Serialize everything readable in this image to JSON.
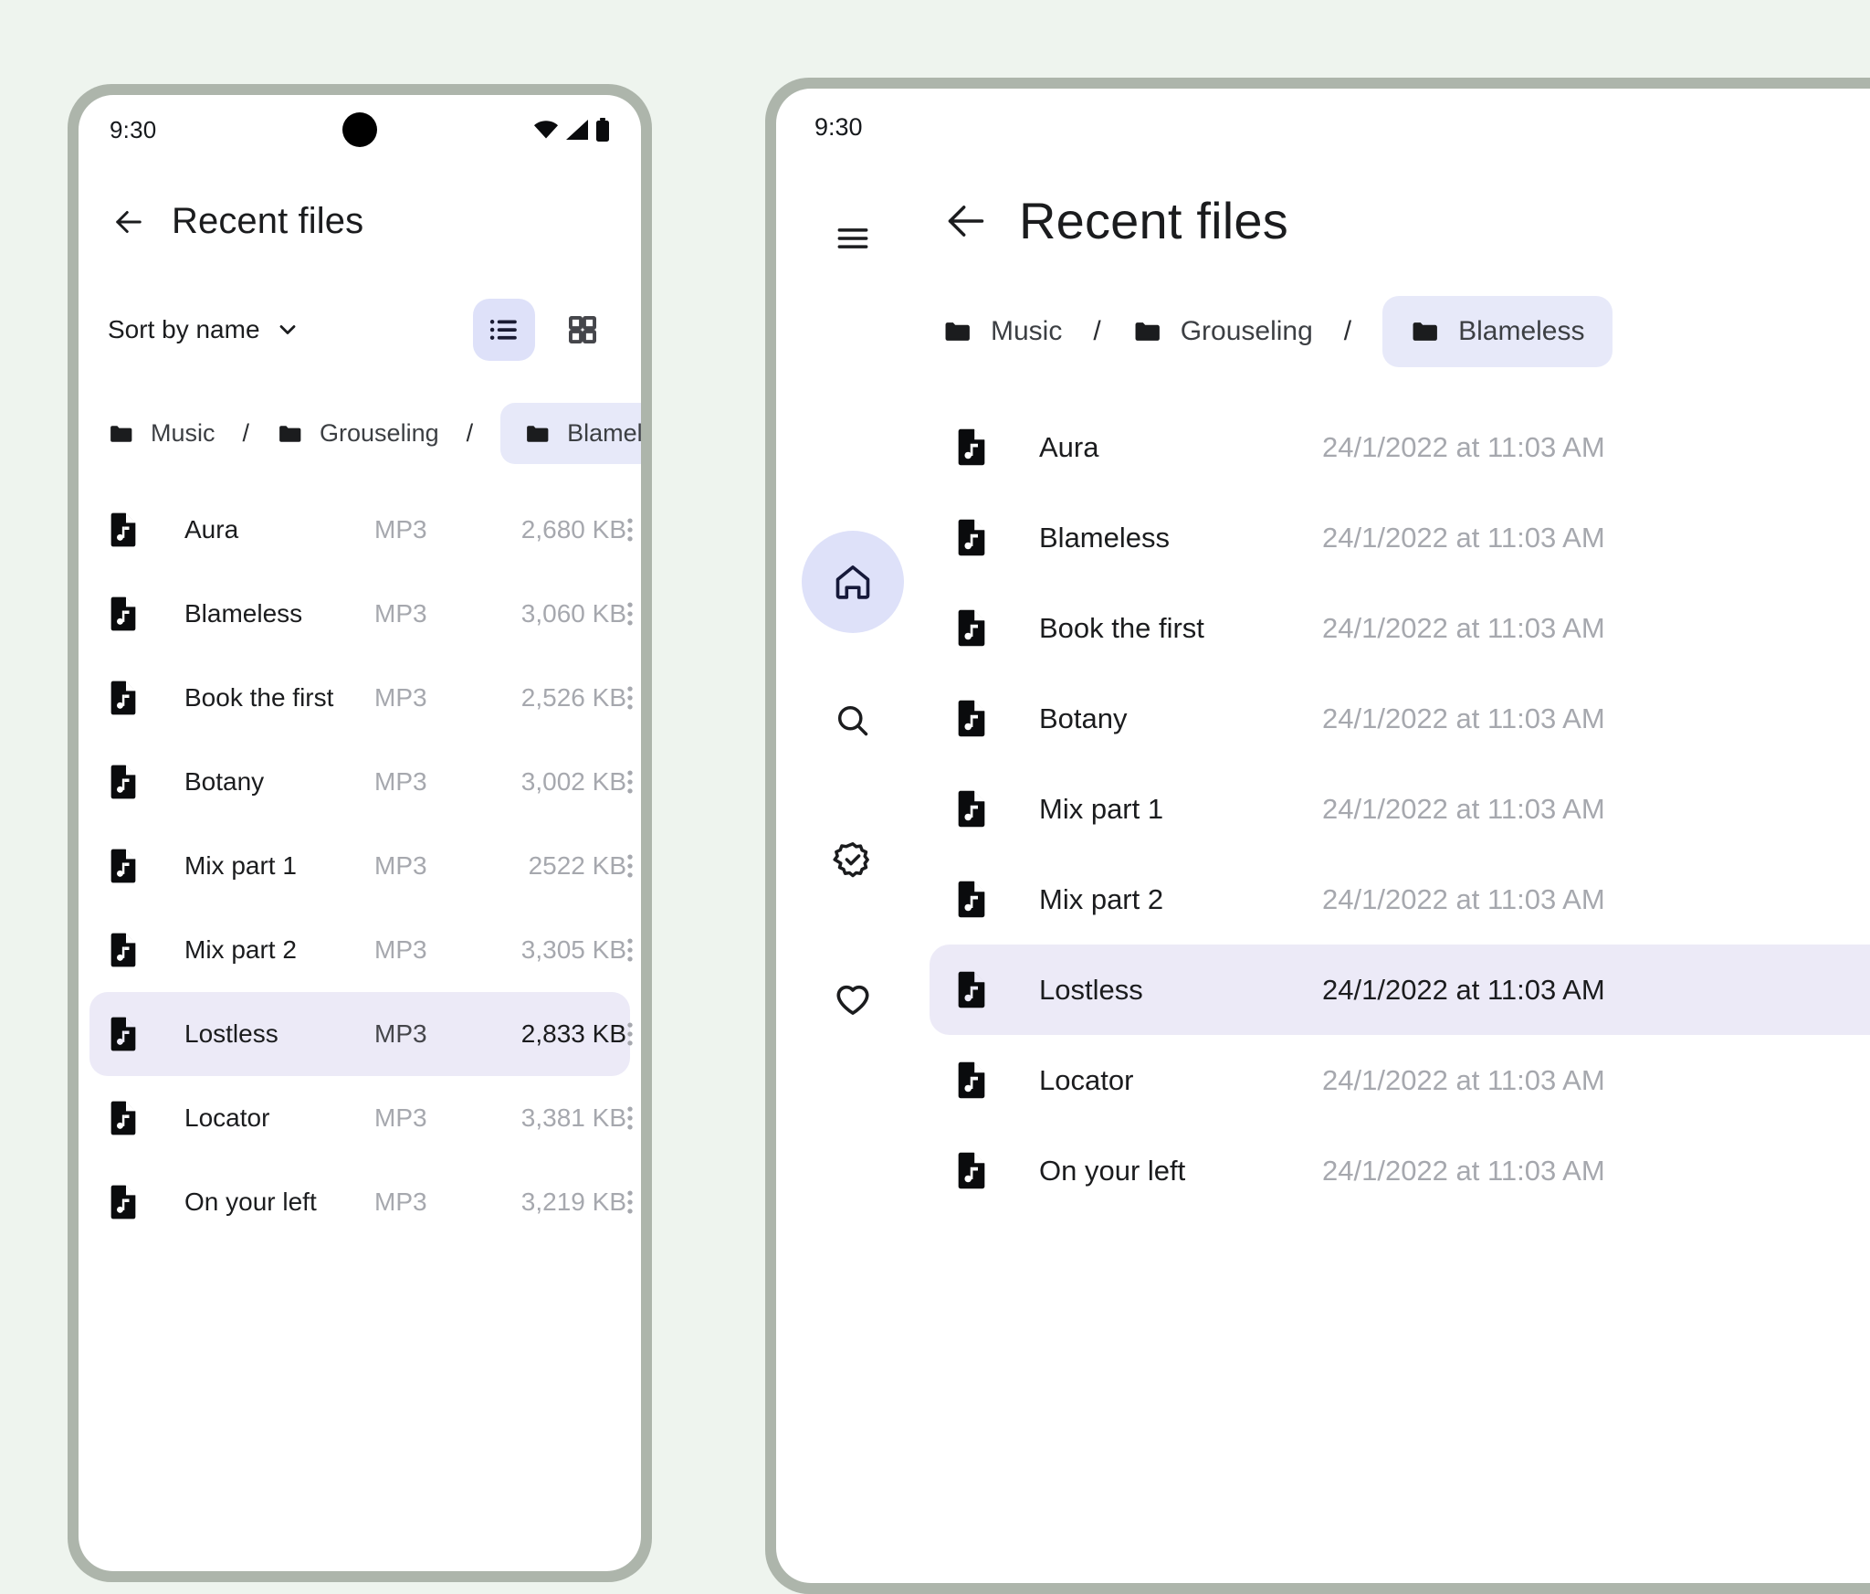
{
  "phone": {
    "status": {
      "time": "9:30",
      "icons": [
        "wifi-icon",
        "signal-icon",
        "battery-icon"
      ]
    },
    "appbar": {
      "back_icon": "arrow-back-icon",
      "title": "Recent files"
    },
    "controls": {
      "sort_label": "Sort by name",
      "sort_chevron_icon": "chevron-down-icon",
      "view_list_icon": "list-view-icon",
      "view_grid_icon": "grid-view-icon",
      "selected_view": "list"
    },
    "breadcrumbs": {
      "separator": "/",
      "items": [
        {
          "label": "Music",
          "icon": "folder-icon",
          "active": false
        },
        {
          "label": "Grouseling",
          "icon": "folder-icon",
          "active": false
        },
        {
          "label": "Blameless",
          "icon": "folder-icon",
          "active": true
        }
      ]
    },
    "files": [
      {
        "name": "Aura",
        "type": "MP3",
        "size": "2,680 KB",
        "selected": false
      },
      {
        "name": "Blameless",
        "type": "MP3",
        "size": "3,060 KB",
        "selected": false
      },
      {
        "name": "Book the first",
        "type": "MP3",
        "size": "2,526 KB",
        "selected": false
      },
      {
        "name": "Botany",
        "type": "MP3",
        "size": "3,002 KB",
        "selected": false
      },
      {
        "name": "Mix part 1",
        "type": "MP3",
        "size": "2522 KB",
        "selected": false
      },
      {
        "name": "Mix part 2",
        "type": "MP3",
        "size": "3,305 KB",
        "selected": false
      },
      {
        "name": "Lostless",
        "type": "MP3",
        "size": "2,833 KB",
        "selected": true
      },
      {
        "name": "Locator",
        "type": "MP3",
        "size": "3,381 KB",
        "selected": false
      },
      {
        "name": "On your left",
        "type": "MP3",
        "size": "3,219 KB",
        "selected": false
      }
    ]
  },
  "tablet": {
    "status": {
      "time": "9:30"
    },
    "nav_rail": {
      "menu_icon": "hamburger-menu-icon",
      "items": [
        {
          "icon": "home-icon",
          "selected": true
        },
        {
          "icon": "search-icon",
          "selected": false
        },
        {
          "icon": "verified-badge-icon",
          "selected": false
        },
        {
          "icon": "heart-icon",
          "selected": false
        }
      ]
    },
    "appbar": {
      "back_icon": "arrow-back-icon",
      "title": "Recent files"
    },
    "breadcrumbs": {
      "separator": "/",
      "items": [
        {
          "label": "Music",
          "icon": "folder-icon",
          "active": false
        },
        {
          "label": "Grouseling",
          "icon": "folder-icon",
          "active": false
        },
        {
          "label": "Blameless",
          "icon": "folder-icon",
          "active": true
        }
      ]
    },
    "files": [
      {
        "name": "Aura",
        "date": "24/1/2022 at 11:03 AM",
        "selected": false
      },
      {
        "name": "Blameless",
        "date": "24/1/2022 at 11:03 AM",
        "selected": false
      },
      {
        "name": "Book the first",
        "date": "24/1/2022 at 11:03 AM",
        "selected": false
      },
      {
        "name": "Botany",
        "date": "24/1/2022 at 11:03 AM",
        "selected": false
      },
      {
        "name": "Mix part 1",
        "date": "24/1/2022 at 11:03 AM",
        "selected": false
      },
      {
        "name": "Mix part 2",
        "date": "24/1/2022 at 11:03 AM",
        "selected": false
      },
      {
        "name": "Lostless",
        "date": "24/1/2022 at 11:03 AM",
        "selected": true
      },
      {
        "name": "Locator",
        "date": "24/1/2022 at 11:03 AM",
        "selected": false
      },
      {
        "name": "On your left",
        "date": "24/1/2022 at 11:03 AM",
        "selected": false
      }
    ]
  },
  "colors": {
    "page_background": "#eef4ee",
    "device_bezel": "#adb5ab",
    "accent_container": "#dee1f9",
    "selected_row": "#eceaf7",
    "chip": "#e7e9f9",
    "text_primary": "#1b1c1e",
    "text_muted": "#a6a8ae"
  }
}
